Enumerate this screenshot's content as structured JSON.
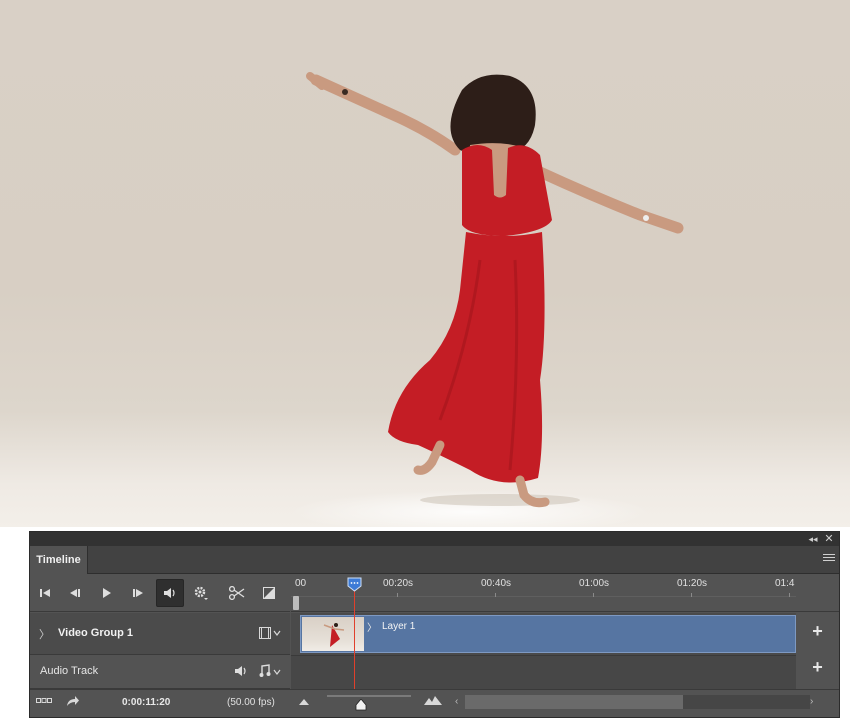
{
  "canvas": {
    "subject": "photo-woman-red-dress"
  },
  "panel": {
    "tab_label": "Timeline",
    "collapse_glyph": "◂◂",
    "close_glyph": "✕",
    "icons": [
      "double-arrow-icon",
      "close-icon",
      "panel-menu-icon"
    ]
  },
  "controls": {
    "buttons": [
      "go-to-first-frame",
      "previous-frame",
      "play",
      "next-frame",
      "mute-audio",
      "settings",
      "split-at-playhead",
      "transition"
    ],
    "active_button": "mute-audio"
  },
  "ruler": {
    "ticks": [
      "00",
      "00:20s",
      "00:40s",
      "01:00s",
      "01:20s",
      "01:4"
    ]
  },
  "tracks": {
    "video_group": {
      "label": "Video Group 1",
      "chevron": "〉",
      "clip_label": "Layer 1",
      "clip_chevron": "〉",
      "clip_color": "#5675a2"
    },
    "audio_track": {
      "label": "Audio Track"
    },
    "add_glyph": "+"
  },
  "playhead": {
    "time": "0:00:11:20",
    "color": "#e0402c",
    "handle_color": "#3d7bd6"
  },
  "bottom": {
    "timecode": "0:00:11:20",
    "fps": "(50.00 fps)",
    "zoom_level": 0.4,
    "scroll_left_glyph": "‹",
    "scroll_right_glyph": "›"
  }
}
